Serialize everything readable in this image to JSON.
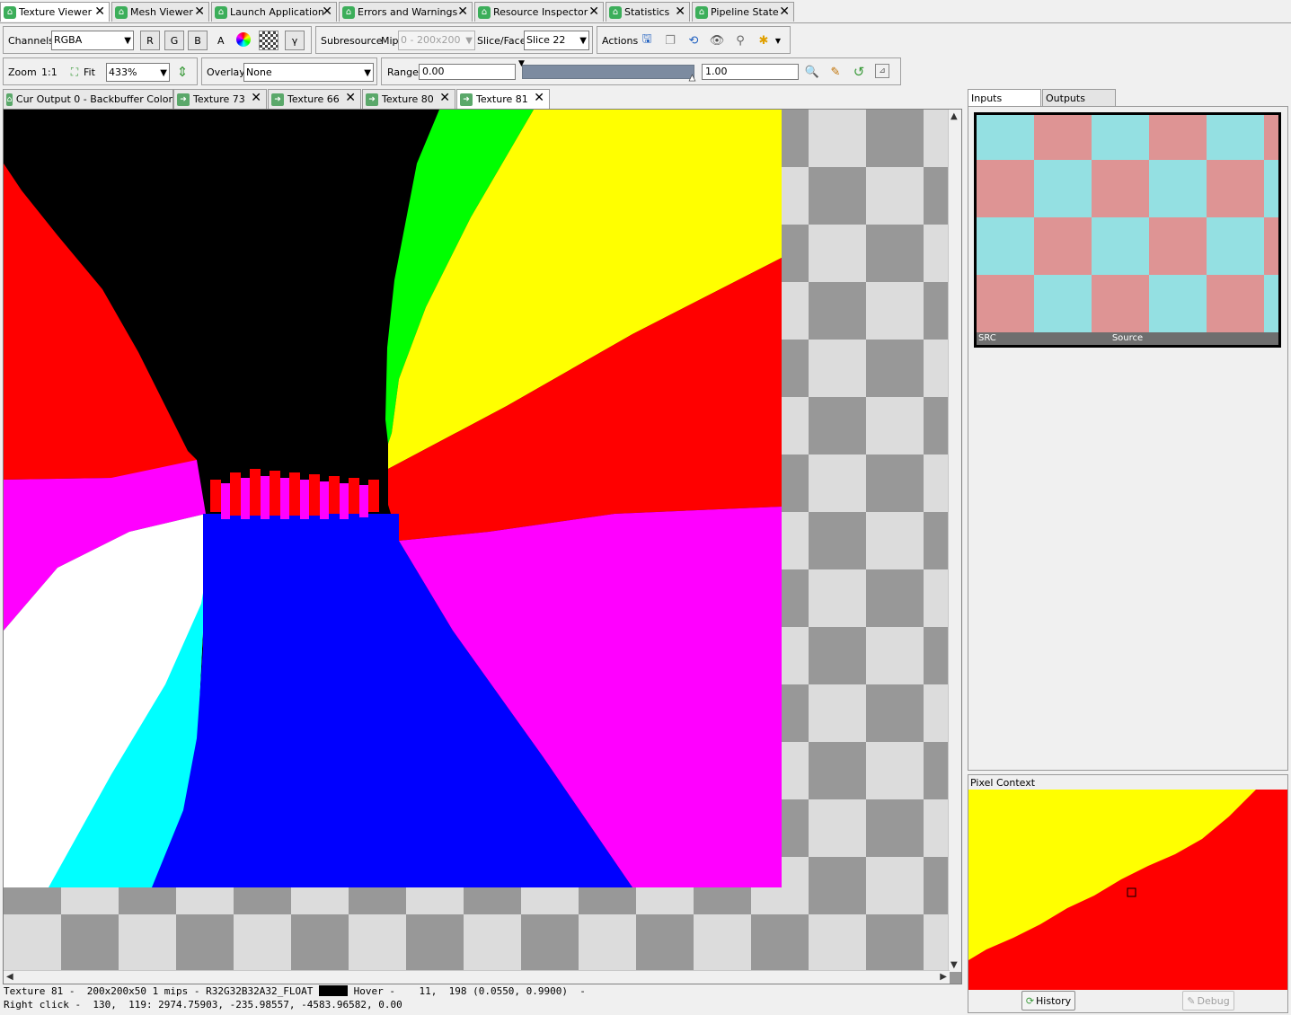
{
  "top_tabs": [
    {
      "label": "Texture Viewer",
      "active": true
    },
    {
      "label": "Mesh Viewer"
    },
    {
      "label": "Launch Application"
    },
    {
      "label": "Errors and Warnings"
    },
    {
      "label": "Resource Inspector"
    },
    {
      "label": "Statistics"
    },
    {
      "label": "Pipeline State"
    }
  ],
  "toolbar1": {
    "channels_label": "Channels",
    "channels_value": "RGBA",
    "r": "R",
    "g": "G",
    "b": "B",
    "a": "A",
    "gamma": "γ",
    "subresource_label": "Subresource",
    "mip_label": "Mip",
    "mip_value": "0 - 200x200",
    "slice_label": "Slice/Face",
    "slice_value": "Slice 22",
    "actions_label": "Actions"
  },
  "toolbar2": {
    "zoom_label": "Zoom",
    "zoom_1to1": "1:1",
    "fit_label": "Fit",
    "zoom_value": "433%",
    "overlay_label": "Overlay",
    "overlay_value": "None",
    "range_label": "Range",
    "range_min": "0.00",
    "range_max": "1.00"
  },
  "doc_tabs": [
    {
      "label": "Cur Output 0 - Backbuffer Color"
    },
    {
      "label": "Texture 73"
    },
    {
      "label": "Texture 66"
    },
    {
      "label": "Texture 80"
    },
    {
      "label": "Texture 81",
      "active": true
    }
  ],
  "status": {
    "line1_prefix": "Texture 81 -  200x200x50 1 mips - R32G32B32A32_FLOAT",
    "line1_suffix": "Hover -    11,  198 (0.0550, 0.9900)  -",
    "line2": "Right click -  130,  119: 2974.75903, -235.98557, -4583.96582, 0.00",
    "swatch_color": "#000000"
  },
  "right_panel": {
    "tabs": [
      {
        "label": "Inputs",
        "active": true
      },
      {
        "label": "Outputs"
      }
    ],
    "thumb_left": "SRC",
    "thumb_center": "Source",
    "pixel_context_label": "Pixel Context",
    "history_button": "History",
    "debug_button": "Debug"
  },
  "colors": {
    "thumb_pink": "#de9494",
    "thumb_cyan": "#94e0e2",
    "red": "#ff0000",
    "yellow": "#ffff00",
    "green": "#00ff00",
    "blue": "#0000ff",
    "magenta": "#ff00ff",
    "cyan": "#00ffff"
  }
}
